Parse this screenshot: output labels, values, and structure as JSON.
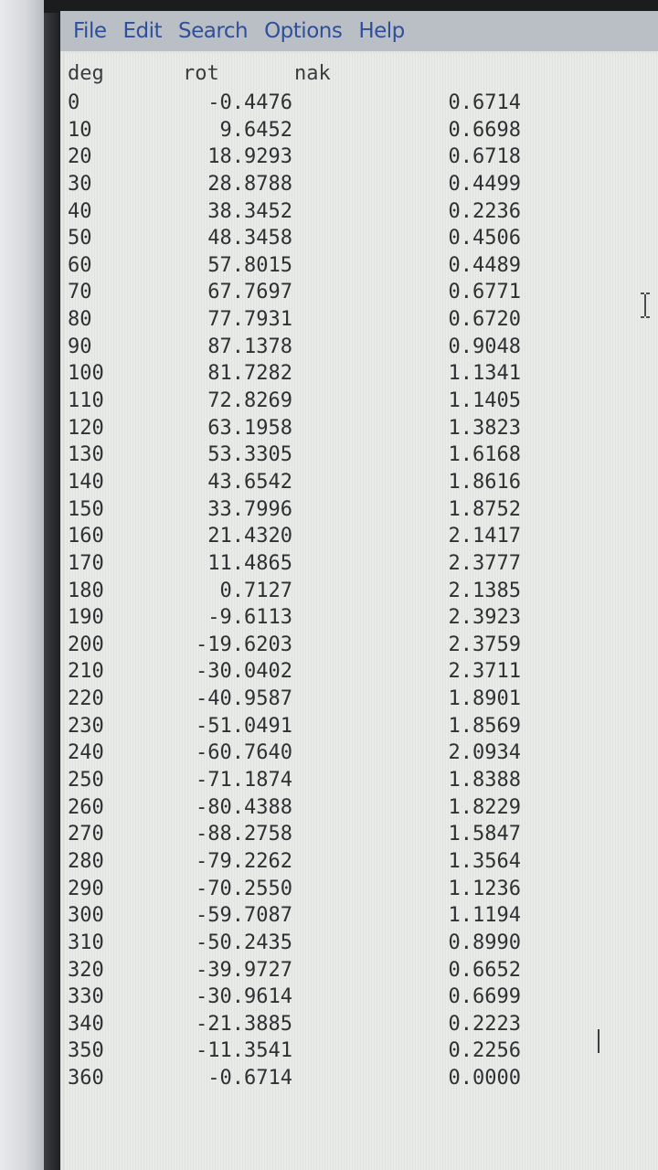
{
  "menu": {
    "items": [
      {
        "label": "File"
      },
      {
        "label": "Edit"
      },
      {
        "label": "Search"
      },
      {
        "label": "Options"
      },
      {
        "label": "Help"
      }
    ]
  },
  "table": {
    "headers": {
      "deg": "deg",
      "rot": "rot",
      "nak": "nak"
    },
    "rows": [
      {
        "deg": "0",
        "rot": "-0.4476",
        "nak": "0.6714"
      },
      {
        "deg": "10",
        "rot": "9.6452",
        "nak": "0.6698"
      },
      {
        "deg": "20",
        "rot": "18.9293",
        "nak": "0.6718"
      },
      {
        "deg": "30",
        "rot": "28.8788",
        "nak": "0.4499"
      },
      {
        "deg": "40",
        "rot": "38.3452",
        "nak": "0.2236"
      },
      {
        "deg": "50",
        "rot": "48.3458",
        "nak": "0.4506"
      },
      {
        "deg": "60",
        "rot": "57.8015",
        "nak": "0.4489"
      },
      {
        "deg": "70",
        "rot": "67.7697",
        "nak": "0.6771"
      },
      {
        "deg": "80",
        "rot": "77.7931",
        "nak": "0.6720"
      },
      {
        "deg": "90",
        "rot": "87.1378",
        "nak": "0.9048"
      },
      {
        "deg": "100",
        "rot": "81.7282",
        "nak": "1.1341"
      },
      {
        "deg": "110",
        "rot": "72.8269",
        "nak": "1.1405"
      },
      {
        "deg": "120",
        "rot": "63.1958",
        "nak": "1.3823"
      },
      {
        "deg": "130",
        "rot": "53.3305",
        "nak": "1.6168"
      },
      {
        "deg": "140",
        "rot": "43.6542",
        "nak": "1.8616"
      },
      {
        "deg": "150",
        "rot": "33.7996",
        "nak": "1.8752"
      },
      {
        "deg": "160",
        "rot": "21.4320",
        "nak": "2.1417"
      },
      {
        "deg": "170",
        "rot": "11.4865",
        "nak": "2.3777"
      },
      {
        "deg": "180",
        "rot": "0.7127",
        "nak": "2.1385"
      },
      {
        "deg": "190",
        "rot": "-9.6113",
        "nak": "2.3923"
      },
      {
        "deg": "200",
        "rot": "-19.6203",
        "nak": "2.3759"
      },
      {
        "deg": "210",
        "rot": "-30.0402",
        "nak": "2.3711"
      },
      {
        "deg": "220",
        "rot": "-40.9587",
        "nak": "1.8901"
      },
      {
        "deg": "230",
        "rot": "-51.0491",
        "nak": "1.8569"
      },
      {
        "deg": "240",
        "rot": "-60.7640",
        "nak": "2.0934"
      },
      {
        "deg": "250",
        "rot": "-71.1874",
        "nak": "1.8388"
      },
      {
        "deg": "260",
        "rot": "-80.4388",
        "nak": "1.8229"
      },
      {
        "deg": "270",
        "rot": "-88.2758",
        "nak": "1.5847"
      },
      {
        "deg": "280",
        "rot": "-79.2262",
        "nak": "1.3564"
      },
      {
        "deg": "290",
        "rot": "-70.2550",
        "nak": "1.1236"
      },
      {
        "deg": "300",
        "rot": "-59.7087",
        "nak": "1.1194"
      },
      {
        "deg": "310",
        "rot": "-50.2435",
        "nak": "0.8990"
      },
      {
        "deg": "320",
        "rot": "-39.9727",
        "nak": "0.6652"
      },
      {
        "deg": "330",
        "rot": "-30.9614",
        "nak": "0.6699"
      },
      {
        "deg": "340",
        "rot": "-21.3885",
        "nak": "0.2223"
      },
      {
        "deg": "350",
        "rot": "-11.3541",
        "nak": "0.2256"
      },
      {
        "deg": "360",
        "rot": "-0.6714",
        "nak": "0.0000"
      }
    ]
  },
  "icons": {
    "mouse_cursor": "i-beam-cursor-icon",
    "text_caret": "text-caret"
  },
  "colors": {
    "menu_text": "#2f4f9c",
    "menu_bg": "#b9bfc4",
    "editor_bg": "#e9ebe8",
    "text": "#2f3033"
  }
}
